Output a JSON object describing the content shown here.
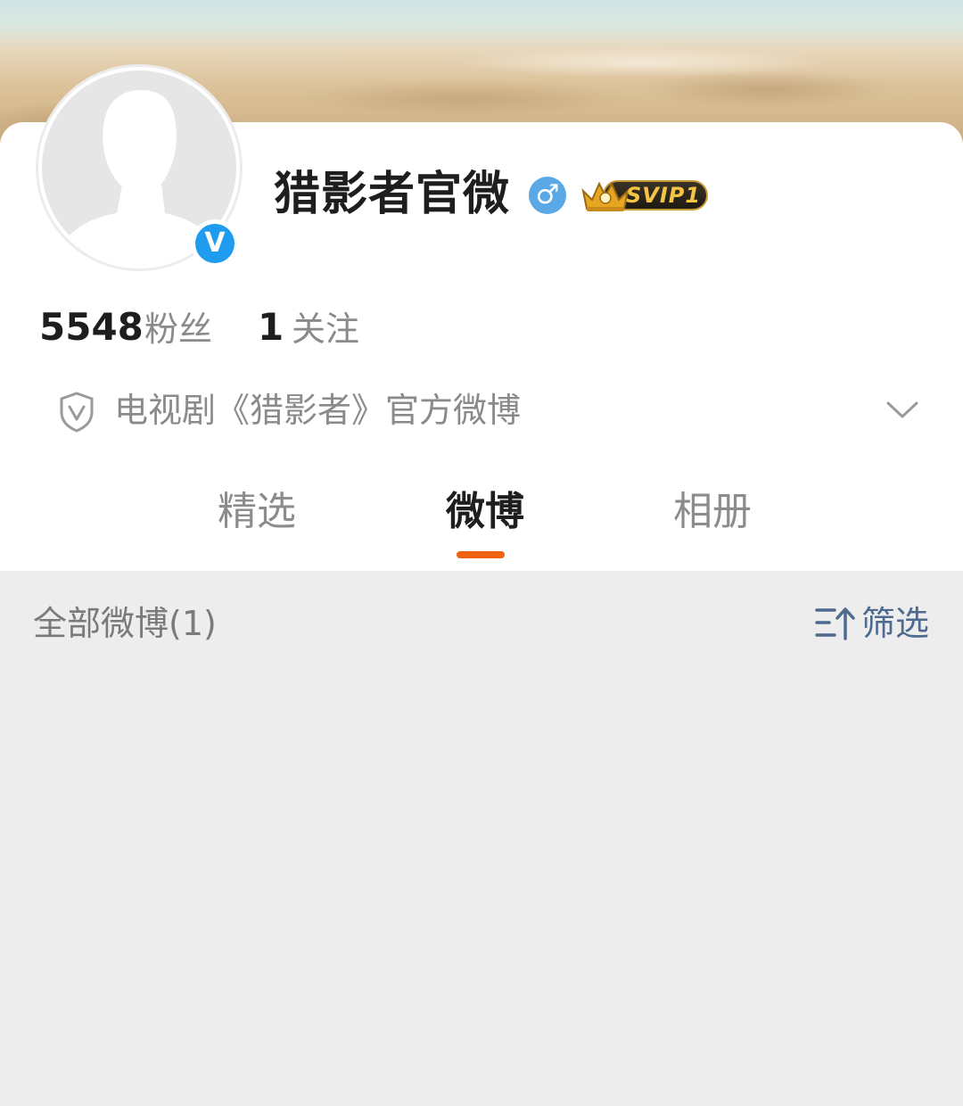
{
  "profile": {
    "name": "猎影者官微",
    "gender_icon": "male-icon",
    "vip_badge": "SVIP1",
    "verified_mark": "V"
  },
  "stats": {
    "fans_count": "5548",
    "fans_label": "粉丝",
    "following_count": "1",
    "following_label": "关注"
  },
  "description": {
    "text": "电视剧《猎影者》官方微博",
    "icon": "shield-v-icon",
    "expand_icon": "chevron-down-icon"
  },
  "tabs": [
    {
      "label": "精选",
      "active": false
    },
    {
      "label": "微博",
      "active": true
    },
    {
      "label": "相册",
      "active": false
    }
  ],
  "feed": {
    "title": "全部微博(1)",
    "filter_label": "筛选",
    "filter_icon": "sort-filter-icon"
  },
  "colors": {
    "accent": "#f0620f",
    "verified_blue": "#1f9bf0",
    "gender_blue": "#5aa9e6",
    "link_blue": "#4e6a8f",
    "page_bg": "#ededed"
  }
}
